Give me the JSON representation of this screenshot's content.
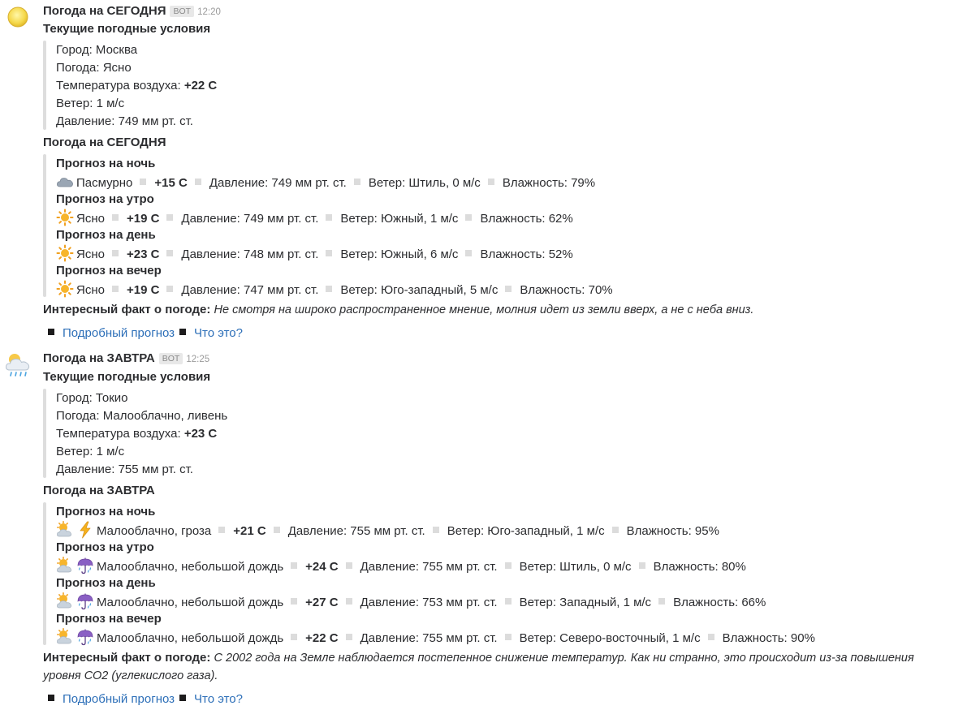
{
  "messages": [
    {
      "sender": "Погода на СЕГОДНЯ",
      "bot_tag": "BOT",
      "time": "12:20",
      "avatar_icon": "sun-icon",
      "current_title": "Текущие погодные условия",
      "current": [
        {
          "label": "Город: ",
          "value": "Москва",
          "bold": false
        },
        {
          "label": "Погода: ",
          "value": "Ясно",
          "bold": false
        },
        {
          "label": "Температура воздуха: ",
          "value": "+22 С",
          "bold": true
        },
        {
          "label": "Ветер: ",
          "value": "1 м/с",
          "bold": false
        },
        {
          "label": "Давление: ",
          "value": "749 мм рт. ст.",
          "bold": false
        }
      ],
      "forecast_title": "Погода на СЕГОДНЯ",
      "forecasts": [
        {
          "title": "Прогноз на ночь",
          "icons": [
            "cloud-icon"
          ],
          "condition": "Пасмурно",
          "temp": "+15 С",
          "pressure": "Давление: 749 мм рт. ст.",
          "wind": "Ветер: Штиль, 0 м/с",
          "humidity": "Влажность: 79%"
        },
        {
          "title": "Прогноз на утро",
          "icons": [
            "sun-icon"
          ],
          "condition": "Ясно",
          "temp": "+19 С",
          "pressure": "Давление: 749 мм рт. ст.",
          "wind": "Ветер: Южный, 1 м/с",
          "humidity": "Влажность: 62%"
        },
        {
          "title": "Прогноз на день",
          "icons": [
            "sun-icon"
          ],
          "condition": "Ясно",
          "temp": "+23 С",
          "pressure": "Давление: 748 мм рт. ст.",
          "wind": "Ветер: Южный, 6 м/с",
          "humidity": "Влажность: 52%"
        },
        {
          "title": "Прогноз на вечер",
          "icons": [
            "sun-icon"
          ],
          "condition": "Ясно",
          "temp": "+19 С",
          "pressure": "Давление: 747 мм рт. ст.",
          "wind": "Ветер: Юго-западный, 5 м/с",
          "humidity": "Влажность: 70%"
        }
      ],
      "fact_label": "Интересный факт о погоде:",
      "fact_text": "Не смотря на широко распространенное мнение, молния идет из земли вверх, а не с неба вниз.",
      "links": [
        "Подробный прогноз",
        "Что это?"
      ]
    },
    {
      "sender": "Погода на ЗАВТРА",
      "bot_tag": "BOT",
      "time": "12:25",
      "avatar_icon": "rain-cloud-icon",
      "current_title": "Текущие погодные условия",
      "current": [
        {
          "label": "Город: ",
          "value": "Токио",
          "bold": false
        },
        {
          "label": "Погода: ",
          "value": "Малооблачно, ливень",
          "bold": false
        },
        {
          "label": "Температура воздуха: ",
          "value": "+23 С",
          "bold": true
        },
        {
          "label": "Ветер: ",
          "value": "1 м/с",
          "bold": false
        },
        {
          "label": "Давление: ",
          "value": "755 мм рт. ст.",
          "bold": false
        }
      ],
      "forecast_title": "Погода на ЗАВТРА",
      "forecasts": [
        {
          "title": "Прогноз на ночь",
          "icons": [
            "sun-behind-cloud-icon",
            "lightning-icon"
          ],
          "condition": "Малооблачно, гроза",
          "temp": "+21 С",
          "pressure": "Давление: 755 мм рт. ст.",
          "wind": "Ветер: Юго-западный, 1 м/с",
          "humidity": "Влажность: 95%"
        },
        {
          "title": "Прогноз на утро",
          "icons": [
            "sun-behind-cloud-icon",
            "umbrella-rain-icon"
          ],
          "condition": "Малооблачно, небольшой дождь",
          "temp": "+24 С",
          "pressure": "Давление: 755 мм рт. ст.",
          "wind": "Ветер: Штиль, 0 м/с",
          "humidity": "Влажность: 80%"
        },
        {
          "title": "Прогноз на день",
          "icons": [
            "sun-behind-cloud-icon",
            "umbrella-rain-icon"
          ],
          "condition": "Малооблачно, небольшой дождь",
          "temp": "+27 С",
          "pressure": "Давление: 753 мм рт. ст.",
          "wind": "Ветер: Западный, 1 м/с",
          "humidity": "Влажность: 66%"
        },
        {
          "title": "Прогноз на вечер",
          "icons": [
            "sun-behind-cloud-icon",
            "umbrella-rain-icon"
          ],
          "condition": "Малооблачно, небольшой дождь",
          "temp": "+22 С",
          "pressure": "Давление: 755 мм рт. ст.",
          "wind": "Ветер: Северо-восточный, 1 м/с",
          "humidity": "Влажность: 90%"
        }
      ],
      "fact_label": "Интересный факт о погоде:",
      "fact_text": "С 2002 года на Земле наблюдается постепенное снижение температур. Как ни странно, это происходит из-за повышения уровня СО2 (углекислого газа).",
      "links": [
        "Подробный прогноз",
        "Что это?"
      ]
    }
  ],
  "colors": {
    "link": "#2d6fb8",
    "quote_bar": "#dddddd",
    "separator": "#dcdcdc",
    "bot_tag_bg": "#e8e8e8"
  }
}
